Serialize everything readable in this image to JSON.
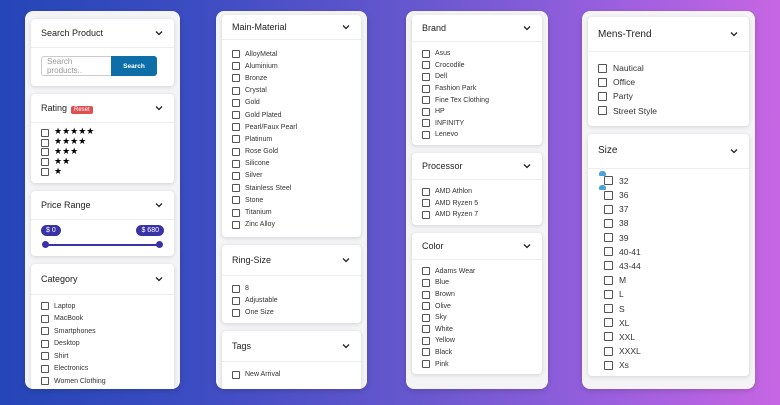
{
  "panel1": {
    "search": {
      "title": "Search Product",
      "placeholder": "Search products..",
      "button": "Search"
    },
    "rating": {
      "title": "Rating",
      "reset": "Reset",
      "stars": [
        "★★★★★",
        "★★★★",
        "★★★",
        "★★",
        "★"
      ]
    },
    "price": {
      "title": "Price Range",
      "min": "$ 0",
      "max": "$ 680"
    },
    "category": {
      "title": "Category",
      "items": [
        "Laptop",
        "MacBook",
        "Smartphones",
        "Desktop",
        "Shirt",
        "Electronics",
        "Women Clothing"
      ]
    }
  },
  "panel2": {
    "material": {
      "title": "Main-Material",
      "items": [
        "AlloyMetal",
        "Aluminium",
        "Bronze",
        "Crystal",
        "Gold",
        "Gold Plated",
        "Pearl/Faux Pearl",
        "Platinum",
        "Rose Gold",
        "Silicone",
        "Silver",
        "Stainless Steel",
        "Stone",
        "Titanium",
        "Zinc Alloy"
      ]
    },
    "ring": {
      "title": "Ring-Size",
      "items": [
        "8",
        "Adjustable",
        "One Size"
      ]
    },
    "tags": {
      "title": "Tags",
      "items": [
        "New Arrival"
      ]
    }
  },
  "panel3": {
    "brand": {
      "title": "Brand",
      "items": [
        "Asus",
        "Crocodile",
        "Dell",
        "Fashion Park",
        "Fine Tex Clothing",
        "HP",
        "INFINITY",
        "Lenevo"
      ]
    },
    "processor": {
      "title": "Processor",
      "items": [
        "AMD Athlon",
        "AMD Ryzen 5",
        "AMD Ryzen 7"
      ]
    },
    "color": {
      "title": "Color",
      "items": [
        "Adams Wear",
        "Blue",
        "Brown",
        "Olive",
        "Sky",
        "White",
        "Yellow",
        "Black",
        "Pink"
      ]
    }
  },
  "panel4": {
    "trend": {
      "title": "Mens-Trend",
      "items": [
        "Nautical",
        "Office",
        "Party",
        "Street Style"
      ]
    },
    "size": {
      "title": "Size",
      "items": [
        "32",
        "36",
        "37",
        "38",
        "39",
        "40-41",
        "43-44",
        "M",
        "L",
        "S",
        "XL",
        "XXL",
        "XXXL",
        "Xs"
      ]
    }
  }
}
